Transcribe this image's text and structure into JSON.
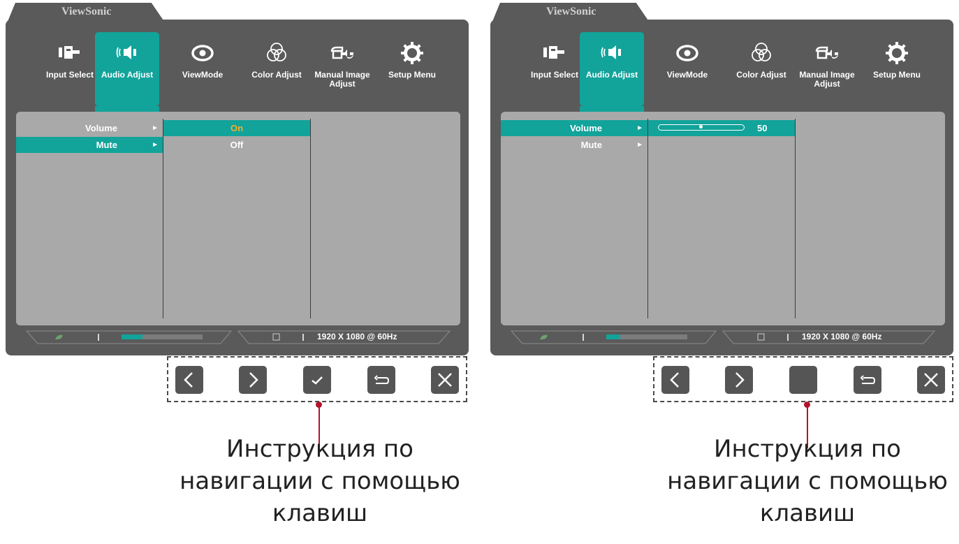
{
  "brand": "ViewSonic",
  "menu_tabs": [
    {
      "label": "Input Select",
      "icon": "input-select-icon"
    },
    {
      "label": "Audio Adjust",
      "icon": "speaker-icon"
    },
    {
      "label": "ViewMode",
      "icon": "eye-icon"
    },
    {
      "label": "Color Adjust",
      "icon": "color-circles-icon"
    },
    {
      "label": "Manual Image Adjust",
      "icon": "hand-wrench-icon"
    },
    {
      "label": "Setup Menu",
      "icon": "gear-icon"
    }
  ],
  "active_tab": "Audio Adjust",
  "accent_color": "#12a39a",
  "highlight_text_color": "#f0b030",
  "submenu": [
    {
      "label": "Volume",
      "arrow": "►"
    },
    {
      "label": "Mute",
      "arrow": "►"
    }
  ],
  "left_screen": {
    "selected_item": "Mute",
    "options": [
      {
        "label": "On",
        "selected": true
      },
      {
        "label": "Off",
        "selected": false
      }
    ]
  },
  "right_screen": {
    "selected_item": "Volume",
    "volume_value": "50",
    "volume_fraction": 0.5
  },
  "status_bar": {
    "resolution": "1920 X 1080 @ 60Hz"
  },
  "nav_buttons_left": [
    "chevron-left-icon",
    "chevron-right-icon",
    "checkmark-icon",
    "return-icon",
    "close-icon"
  ],
  "nav_buttons_right": [
    "chevron-left-icon",
    "chevron-right-icon",
    "blank-icon",
    "return-icon",
    "close-icon"
  ],
  "caption": "Инструкция по навигации с помощью клавиш"
}
